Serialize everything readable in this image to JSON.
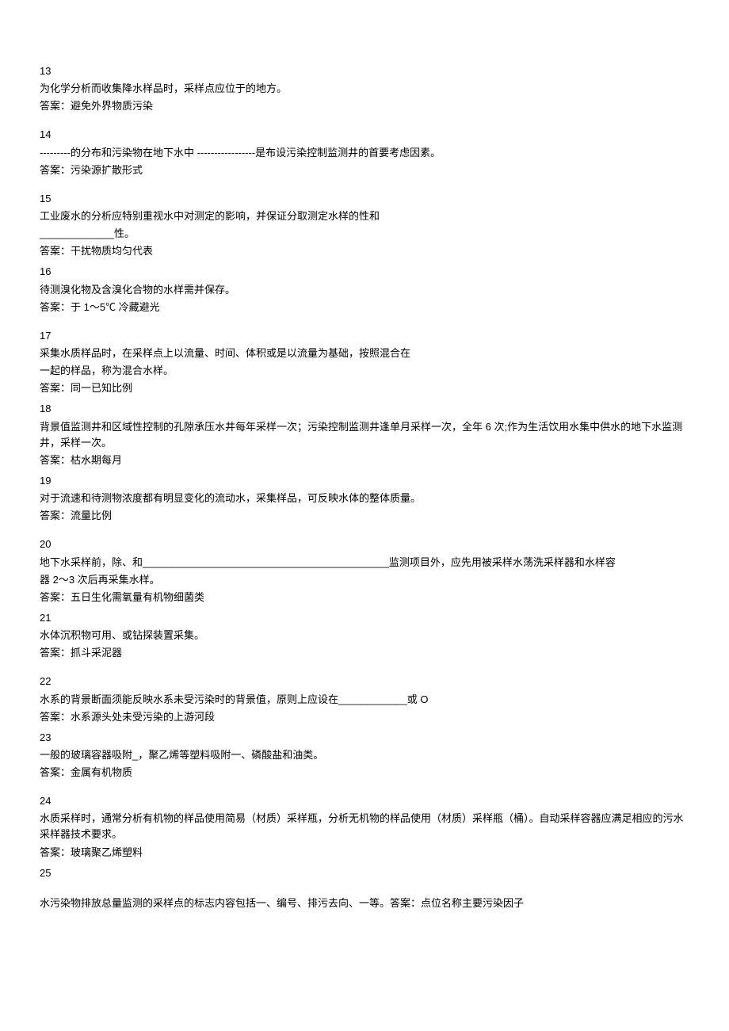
{
  "items": [
    {
      "n": "13",
      "q": [
        "为化学分析而收集降水样品时，采样点应位于的地方。"
      ],
      "a": "答案：避免外界物质污染",
      "tight": false
    },
    {
      "n": "14",
      "q": [
        "---------的分布和污染物在地下水中 -----------------是布设污染控制监测井的首要考虑因素。"
      ],
      "a": "答案：污染源扩散形式",
      "tight": false
    },
    {
      "n": "15",
      "q": [
        "工业废水的分析应特别重视水中对测定的影响，并保证分取测定水样的性和",
        "_____________性。"
      ],
      "a": "答案：干扰物质均匀代表",
      "tight": true
    },
    {
      "n": "16",
      "q": [
        "待测溴化物及含溴化合物的水样需并保存。"
      ],
      "a": "答案：于 1〜5℃ 冷藏避光",
      "tight": false
    },
    {
      "n": "17",
      "q": [
        "采集水质样品时，在采样点上以流量、时间、体积或是以流量为基础，按照混合在",
        "一起的样品，称为混合水样。"
      ],
      "a": "答案：同一已知比例",
      "tight": true
    },
    {
      "n": "18",
      "q": [
        "背景值监测井和区域性控制的孔隙承压水井每年采样一次；污染控制监测井逢单月采样一次，全年 6 次;作为生活饮用水集中供水的地下水监测井，采样一次。"
      ],
      "a": "答案：枯水期每月",
      "tight": true
    },
    {
      "n": "19",
      "q": [
        "对于流速和待测物浓度都有明显变化的流动水，采集样品，可反映水体的整体质量。"
      ],
      "a": "答案：流量比例",
      "tight": false
    },
    {
      "n": "20",
      "q": [
        "地下水采样前，除、和___________________________________________监测项目外，应先用被采样水荡洗采样器和水样容",
        "器 2〜3 次后再采集水样。"
      ],
      "a": "答案：五日生化需氧量有机物细菌类",
      "tight": true
    },
    {
      "n": "21",
      "q": [
        "水体沉积物可用、或钻探装置采集。"
      ],
      "a": "答案：抓斗采泥器",
      "tight": false
    },
    {
      "n": "22",
      "q": [
        "水系的背景断面须能反映水系未受污染时的背景值，原则上应设在____________或 O"
      ],
      "a": "答案：水系源头处未受污染的上游河段",
      "tight": true
    },
    {
      "n": "23",
      "q": [
        "一般的玻璃容器吸附_，聚乙烯等塑料吸附一、磷酸盐和油类。"
      ],
      "a": "答案：金属有机物质",
      "tight": false
    },
    {
      "n": "24",
      "q": [
        "水质采样时，通常分析有机物的样品使用简易（材质）采样瓶，分析无机物的样品使用（材质）采样瓶（桶）。自动采样容器应满足相应的污水采样器技术要求。"
      ],
      "a": "答案：玻璃聚乙烯塑料",
      "tight": true
    },
    {
      "n": "25",
      "q": [
        "",
        "水污染物排放总量监测的采样点的标志内容包括一、编号、排污去向、一等。答案：点位名称主要污染因子"
      ],
      "a": "",
      "tight": false
    }
  ]
}
